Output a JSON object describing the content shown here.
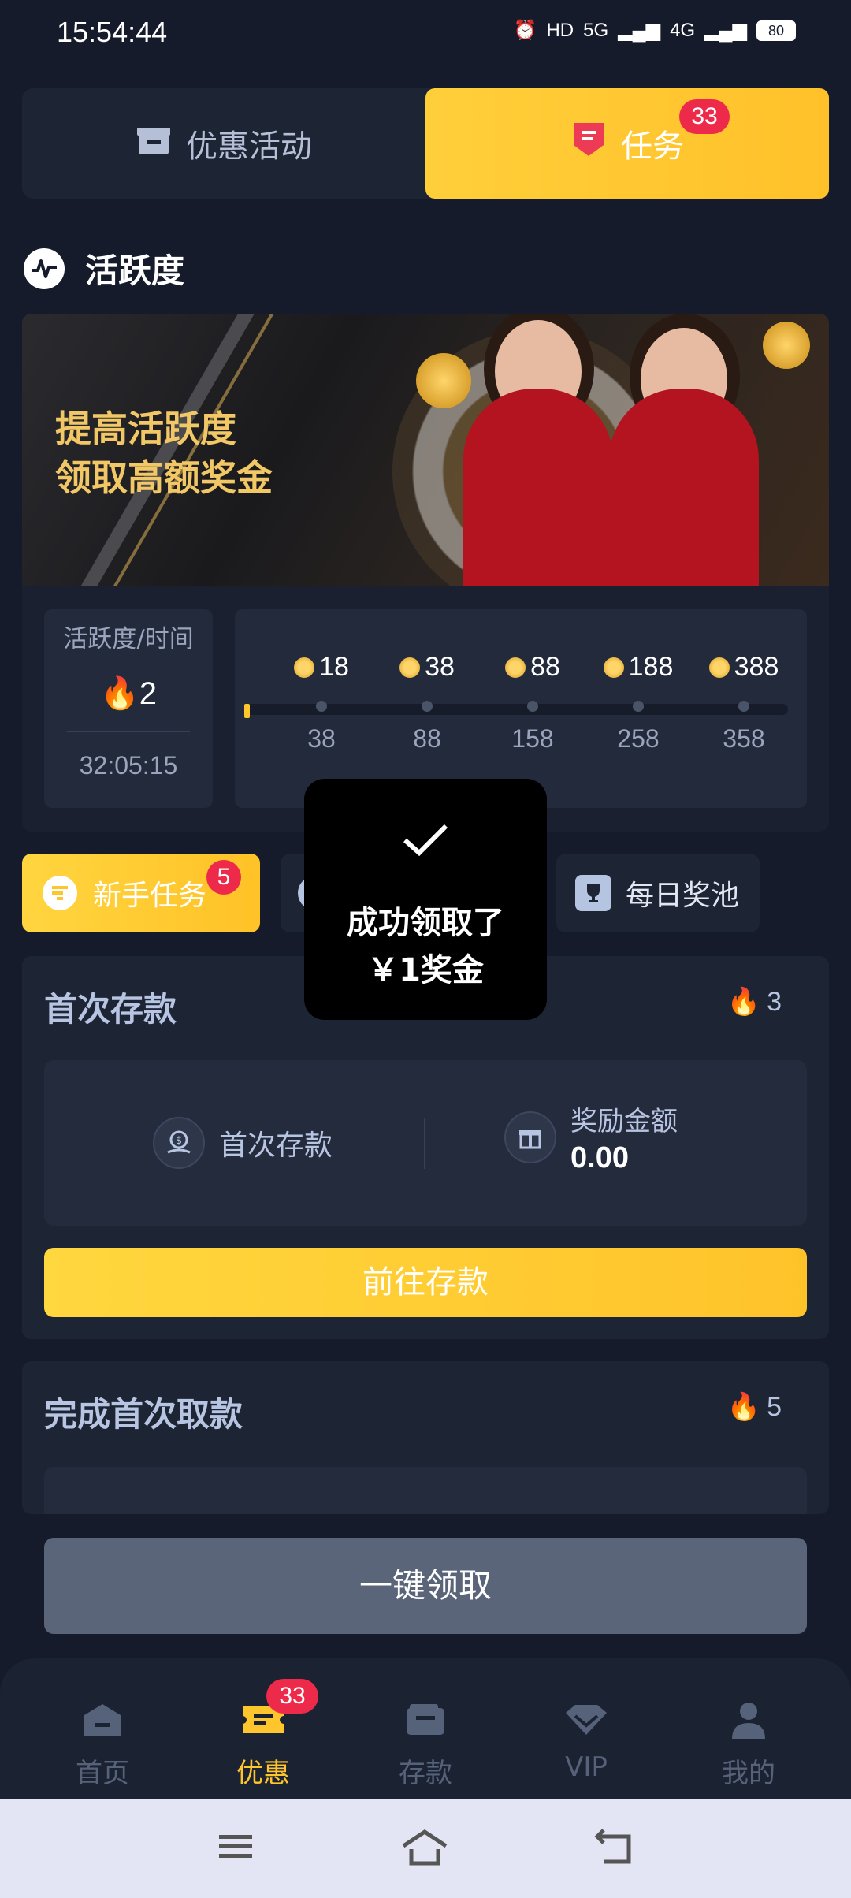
{
  "status": {
    "time": "15:54:44",
    "network1": "5G",
    "network2": "4G",
    "battery": "80"
  },
  "top_tabs": [
    {
      "label": "优惠活动"
    },
    {
      "label": "任务",
      "badge": "33"
    }
  ],
  "activity": {
    "title": "活跃度",
    "banner_line1": "提高活跃度",
    "banner_line2": "领取高额奖金",
    "box_label": "活跃度/时间",
    "score": "2",
    "timer": "32:05:15",
    "progress_fraction": 0.0,
    "milestones": [
      {
        "reward": "18",
        "threshold": "38"
      },
      {
        "reward": "38",
        "threshold": "88"
      },
      {
        "reward": "88",
        "threshold": "158"
      },
      {
        "reward": "188",
        "threshold": "258"
      },
      {
        "reward": "388",
        "threshold": "358"
      }
    ]
  },
  "sub_tabs": [
    {
      "label": "新手任务",
      "badge": "5"
    },
    {
      "label": "每日奖池"
    }
  ],
  "task1": {
    "title": "首次存款",
    "points": "3",
    "left_label": "首次存款",
    "reward_label": "奖励金额",
    "reward_value": "0.00",
    "button": "前往存款"
  },
  "task2": {
    "title": "完成首次取款",
    "points": "5"
  },
  "toast": {
    "line1": "成功领取了",
    "line2": "￥1奖金"
  },
  "claim_all": "一键领取",
  "bottom_nav": [
    {
      "label": "首页"
    },
    {
      "label": "优惠",
      "badge": "33"
    },
    {
      "label": "存款"
    },
    {
      "label": "VIP"
    },
    {
      "label": "我的"
    }
  ],
  "colors": {
    "accent": "#ffc52c",
    "badge": "#ee2a4a",
    "background": "#151b2b"
  }
}
